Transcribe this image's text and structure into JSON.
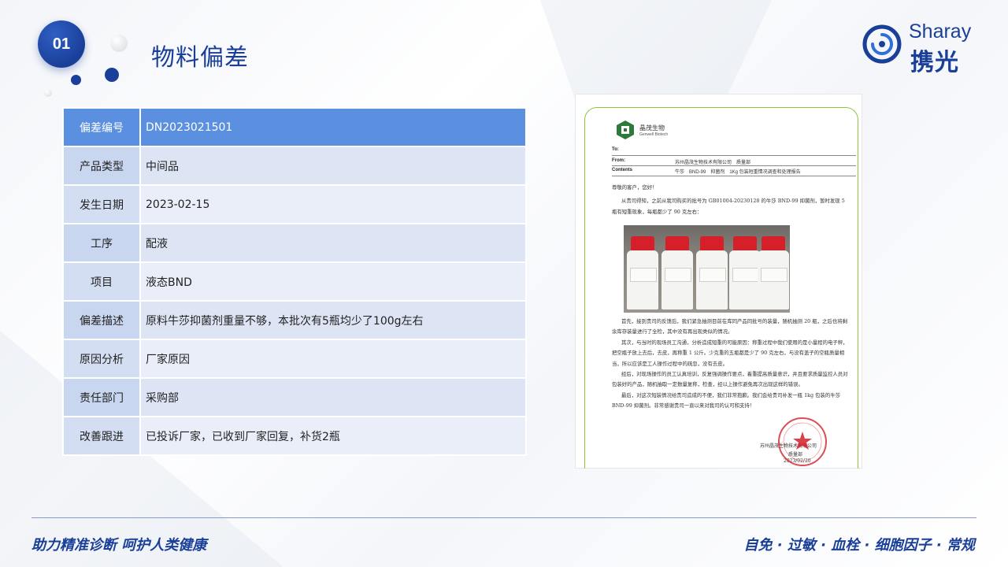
{
  "header": {
    "section_number": "01",
    "title": "物料偏差",
    "logo": {
      "en": "Sharay",
      "cn": "携光"
    }
  },
  "table": {
    "rows": [
      {
        "key": "偏差编号",
        "value": "DN2023021501"
      },
      {
        "key": "产品类型",
        "value": "中间品"
      },
      {
        "key": "发生日期",
        "value": "2023-02-15"
      },
      {
        "key": "工序",
        "value": "配液"
      },
      {
        "key": "项目",
        "value": "液态BND"
      },
      {
        "key": "偏差描述",
        "value": "原料牛莎抑菌剂重量不够，本批次有5瓶均少了100g左右"
      },
      {
        "key": "原因分析",
        "value": "厂家原因"
      },
      {
        "key": "责任部门",
        "value": "采购部"
      },
      {
        "key": "改善跟进",
        "value": "已投诉厂家，已收到厂家回复，补货2瓶"
      }
    ]
  },
  "document": {
    "company": "晶茂生物",
    "company_en": "Genwell Biotech",
    "to_label": "To:",
    "from_label": "From:",
    "from_value": "苏州晶茂生物技术有限公司　质量部",
    "contents_label": "Contents",
    "contents_value": "牛莎　BND-99　抑菌剂　1Kg 包装短重情况调查和处理报告",
    "greeting": "尊敬的客户，您好！",
    "para1": "从贵司得知，之前从我司购买的批号为 GB01004-20230128 的牛莎 BND-99 抑菌剂，暂时发现 5 瓶有短重现象，每瓶都少了 90 克左右：",
    "para2": "首先，接到贵司的反馈后，我们紧急抽测目前在库同产品同批号的装量，随机抽测 20 瓶，之后也将剩余库存装量进行了全检，其中没有再出现类似的情况。",
    "para3": "其次，与当时的现场员工沟通，分析造成短重的可能原因：称重过程中我们使用的是小量程的电子秤，把空瓶子放上去后，去皮，再称重 1 公斤。少克重的五瓶都是少了 90 克左右，与没有盖子的空瓶质量相当，所以应该是工人操作过程中的疏忽，没有去皮。",
    "para4": "经后，对现场操作的员工认真培训，反复强调操作要点，着重提高质量意识，并且要求质量监控人员对包装好的产品，随机抽取一定数量复称，检查，经以上操作避免再次出现这样的错误。",
    "para5": "最后，对这次短装情况给贵司造成的不便，我们非常抱歉。我们会给贵司补发一瓶 1kg 包装的牛莎 BND-99 抑菌剂。非常感谢贵司一直以来对我司的认可和支持！",
    "sign_company": "苏州晶茂生物技术有限公司",
    "sign_dept": "质量部",
    "sign_date": "2023/02/20"
  },
  "footer": {
    "slogan_left": "助力精准诊断 呵护人类健康",
    "slogan_right": "自免 · 过敏 · 血栓 · 细胞因子 · 常规"
  },
  "colors": {
    "brand_blue": "#1a3f99",
    "table_header": "#5b8fe0",
    "doc_frame_green": "#8cc63f",
    "stamp_red": "#d5202a"
  }
}
